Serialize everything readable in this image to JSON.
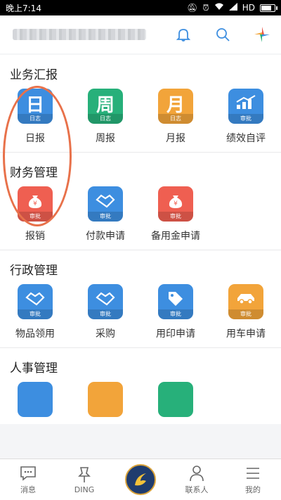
{
  "status_bar": {
    "time": "晚上7:14",
    "network": "HD"
  },
  "header": {
    "title_blurred": ""
  },
  "sections": [
    {
      "title": "业务汇报",
      "items": [
        {
          "label": "日报",
          "glyph": "日",
          "band": "日志",
          "color": "#3d8ee0"
        },
        {
          "label": "周报",
          "glyph": "周",
          "band": "日志",
          "color": "#27b07a"
        },
        {
          "label": "月报",
          "glyph": "月",
          "band": "日志",
          "color": "#f2a43a"
        },
        {
          "label": "绩效自评",
          "glyph": "",
          "band": "审批",
          "color": "#3d8ee0"
        }
      ]
    },
    {
      "title": "财务管理",
      "items": [
        {
          "label": "报销",
          "glyph": "",
          "band": "审批",
          "color": "#ef5f51"
        },
        {
          "label": "付款申请",
          "glyph": "",
          "band": "审批",
          "color": "#3d8ee0"
        },
        {
          "label": "备用金申请",
          "glyph": "",
          "band": "审批",
          "color": "#ef5f51"
        }
      ]
    },
    {
      "title": "行政管理",
      "items": [
        {
          "label": "物品领用",
          "glyph": "",
          "band": "审批",
          "color": "#3d8ee0"
        },
        {
          "label": "采购",
          "glyph": "",
          "band": "审批",
          "color": "#3d8ee0"
        },
        {
          "label": "用印申请",
          "glyph": "",
          "band": "审批",
          "color": "#3d8ee0"
        },
        {
          "label": "用车申请",
          "glyph": "",
          "band": "审批",
          "color": "#f2a43a"
        }
      ]
    },
    {
      "title": "人事管理",
      "items": [
        {
          "label": "",
          "glyph": "",
          "band": "",
          "color": "#3d8ee0"
        },
        {
          "label": "",
          "glyph": "",
          "band": "",
          "color": "#f2a43a"
        },
        {
          "label": "",
          "glyph": "",
          "band": "",
          "color": "#27b07a"
        }
      ]
    }
  ],
  "tabbar": {
    "messages": "消息",
    "ding": "DING",
    "contacts": "联系人",
    "me": "我的"
  },
  "colors": {
    "accent": "#3d8ee0",
    "annotation_circle": "#e8714a"
  }
}
